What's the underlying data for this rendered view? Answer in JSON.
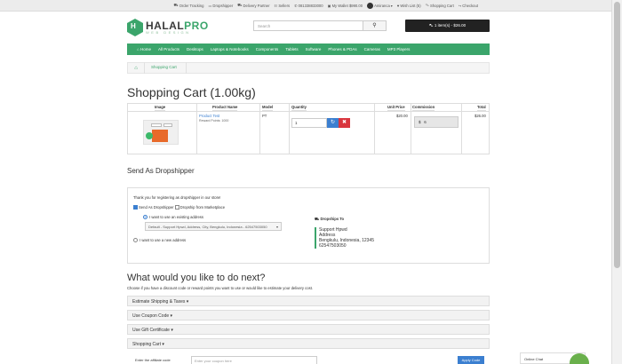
{
  "topbar": {
    "items": [
      "Order Tracking",
      "Dropshipper",
      "Delivery Partner",
      "Sellers",
      "081338833000",
      "My Wallet $990.00",
      "Amiranca",
      "Wish List (5)",
      "Shopping Cart",
      "Checkout"
    ]
  },
  "header": {
    "logo_main": "HALAL",
    "logo_accent": "PRO",
    "logo_sub": "WEB DESIGN",
    "search_placeholder": "Search",
    "cart_label": "1 item(s) - $26.00"
  },
  "nav": {
    "items": [
      "Home",
      "All Products",
      "Desktops",
      "Laptops & Notebooks",
      "Components",
      "Tablets",
      "Software",
      "Phones & PDAs",
      "Cameras",
      "MP3 Players"
    ]
  },
  "breadcrumb": {
    "current": "Shopping Cart"
  },
  "page_title": "Shopping Cart  (1.00kg)",
  "cart_table": {
    "headers": [
      "Image",
      "Product Name",
      "Model",
      "Quantity",
      "Unit Price",
      "Commission",
      "Total"
    ],
    "row": {
      "product_name": "Product Test",
      "reward_points": "Reward Points: 1000",
      "model": "PT",
      "quantity": "1",
      "unit_price": "$20.00",
      "commission_prefix": "$",
      "commission_value": "6",
      "total": "$26.00"
    }
  },
  "dropship": {
    "title": "Send As Dropshipper",
    "thanks": "Thank you for registering as dropshipper in our store!",
    "opt_send": "Send As Dropshipper",
    "opt_marketplace": "Dropship from Marketplace",
    "radio_existing": "I want to use an existing address",
    "address_select": "Default - Support Hpwd, Address, City, Bengkulu, Indonesia - 62547503050",
    "radio_new": "I want to use a new address",
    "ship_to_heading": "Dropships To",
    "ship_to_lines": [
      "Support Hpwd",
      "Address",
      "Bengkulu, Indonesia, 12345",
      "62547503050"
    ]
  },
  "next": {
    "title": "What would you like to do next?",
    "subtitle": "Choose if you have a discount code or reward points you want to use or would like to estimate your delivery cost.",
    "panels": [
      "Estimate Shipping & Taxes ▾",
      "Use Coupon Code ▾",
      "Use Gift Certificate ▾",
      "Shopping Cart ▾"
    ],
    "affiliate_label": "Enter the affiliate code",
    "coupon_placeholder": "Enter your coupon here",
    "apply_label": "Apply Code"
  },
  "chat": {
    "label": "Online Chat"
  }
}
